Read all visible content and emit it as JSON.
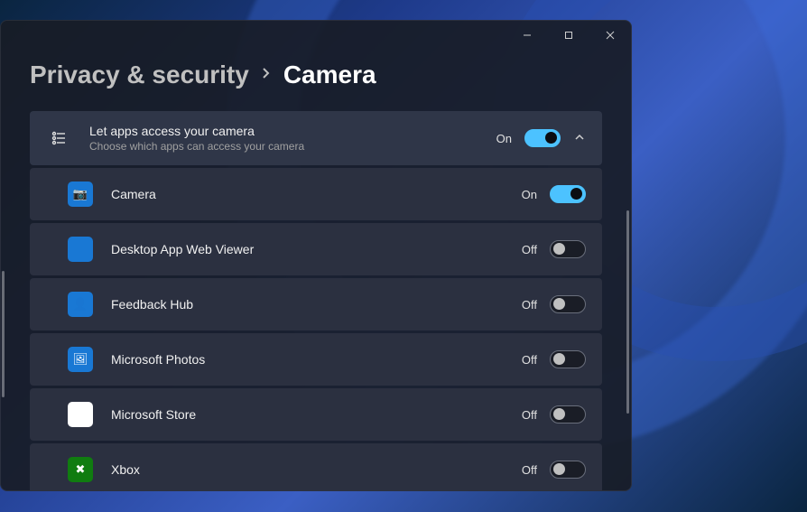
{
  "breadcrumb": {
    "parent": "Privacy & security",
    "current": "Camera"
  },
  "header_row": {
    "title": "Let apps access your camera",
    "desc": "Choose which apps can access your camera",
    "state_label": "On",
    "on": true
  },
  "labels": {
    "on": "On",
    "off": "Off"
  },
  "apps": [
    {
      "name": "Camera",
      "on": true,
      "tile_class": "tile-camera",
      "icon_glyph": "📷"
    },
    {
      "name": "Desktop App Web Viewer",
      "on": false,
      "tile_class": "tile-blank",
      "icon_glyph": ""
    },
    {
      "name": "Feedback Hub",
      "on": false,
      "tile_class": "tile-feedback",
      "icon_glyph": "👤"
    },
    {
      "name": "Microsoft Photos",
      "on": false,
      "tile_class": "tile-photos",
      "icon_glyph": "🖼"
    },
    {
      "name": "Microsoft Store",
      "on": false,
      "tile_class": "tile-store",
      "icon_glyph": "🛍"
    },
    {
      "name": "Xbox",
      "on": false,
      "tile_class": "tile-xbox",
      "icon_glyph": "✖"
    }
  ]
}
